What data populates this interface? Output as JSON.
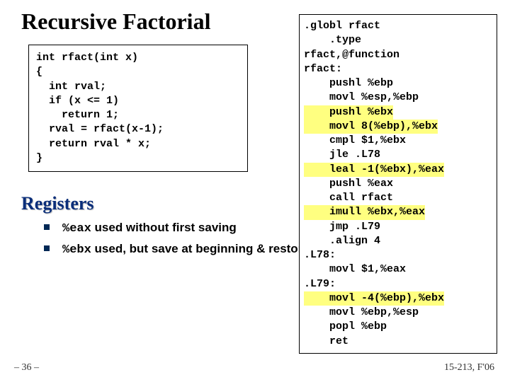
{
  "title": "Recursive Factorial",
  "c_code": "int rfact(int x)\n{\n  int rval;\n  if (x <= 1)\n    return 1;\n  rval = rfact(x-1);\n  return rval * x;\n}",
  "section_heading": "Registers",
  "bullets": [
    {
      "mono": "%eax",
      "rest": " used without first saving"
    },
    {
      "mono": "%ebx",
      "rest": " used, but save at beginning & restore at end"
    }
  ],
  "asm": {
    "lines": [
      {
        "t": ".globl rfact",
        "hl": false
      },
      {
        "t": "    .type",
        "hl": false
      },
      {
        "t": "rfact,@function",
        "hl": false
      },
      {
        "t": "rfact:",
        "hl": false
      },
      {
        "t": "    pushl %ebp",
        "hl": false
      },
      {
        "t": "    movl %esp,%ebp",
        "hl": false
      },
      {
        "t": "    pushl %ebx",
        "hl": true
      },
      {
        "t": "    movl 8(%ebp),%ebx",
        "hl": true
      },
      {
        "t": "    cmpl $1,%ebx",
        "hl": false
      },
      {
        "t": "    jle .L78",
        "hl": false
      },
      {
        "t": "    leal -1(%ebx),%eax",
        "hl": true
      },
      {
        "t": "    pushl %eax",
        "hl": false
      },
      {
        "t": "    call rfact",
        "hl": false
      },
      {
        "t": "    imull %ebx,%eax",
        "hl": true
      },
      {
        "t": "    jmp .L79",
        "hl": false
      },
      {
        "t": "    .align 4",
        "hl": false
      },
      {
        "t": ".L78:",
        "hl": false
      },
      {
        "t": "    movl $1,%eax",
        "hl": false
      },
      {
        "t": ".L79:",
        "hl": false
      },
      {
        "t": "    movl -4(%ebp),%ebx",
        "hl": true
      },
      {
        "t": "    movl %ebp,%esp",
        "hl": false
      },
      {
        "t": "    popl %ebp",
        "hl": false
      },
      {
        "t": "    ret",
        "hl": false
      }
    ]
  },
  "page_num": "– 36 –",
  "course_id": "15-213, F'06"
}
